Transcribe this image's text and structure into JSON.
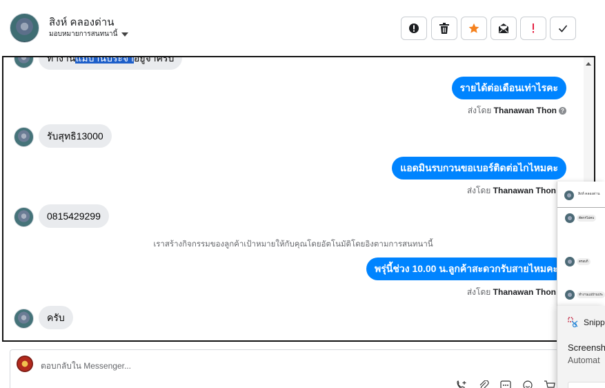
{
  "header": {
    "contact_name": "สิงห์ คลองด่าน",
    "assign_label": "มอบหมายการสนทนานี้"
  },
  "toolbar": {
    "buttons": [
      {
        "icon": "alert-circle-icon"
      },
      {
        "icon": "trash-icon"
      },
      {
        "icon": "star-icon",
        "color": "#f5821f"
      },
      {
        "icon": "mark-unread-icon"
      },
      {
        "icon": "exclamation-icon",
        "color": "#e41e3f"
      },
      {
        "icon": "checkmark-icon"
      }
    ]
  },
  "conversation": {
    "top_partial_message": {
      "before": "ทำงาน",
      "highlighted": "แม่บ้านประจำ",
      "after": "อยู่จ้าครับ"
    },
    "messages": [
      {
        "direction": "out",
        "text": "รายได้ต่อเดือนเท่าไรคะ",
        "sent_by_prefix": "ส่งโดย",
        "sender": "Thanawan Thon"
      },
      {
        "direction": "in",
        "text": "รับสุทธิ13000"
      },
      {
        "direction": "out",
        "text": "แอดมินรบกวนขอเบอร์ติดต่อไกไหมคะ",
        "sent_by_prefix": "ส่งโดย",
        "sender": "Thanawan Thon"
      },
      {
        "direction": "in",
        "text": "0815429299"
      },
      {
        "direction": "out",
        "text": "พรุ่นี้ช่วง 10.00 น.ลูกค้าสะดวกรับสายไหมคะ",
        "sent_by_prefix": "ส่งโดย",
        "sender": "Thanawan Thon"
      },
      {
        "direction": "in",
        "text": "ครับ"
      }
    ],
    "system_note": "เราสร้างกิจกรรมของลูกค้าเป้าหมายให้กับคุณโดยอัตโนมัติโดยอิงตามการสนทนานี้"
  },
  "composer": {
    "placeholder": "ตอบกลับใน Messenger..."
  },
  "snipping_tool": {
    "title": "Snipping Tool",
    "title_visible": "Snipp",
    "line1_visible": "Screensh",
    "line2_visible": "Automat",
    "thumb": {
      "name": "สิงห์ คลองด่าน",
      "bubbles": [
        "ดีตกรไม่คบ",
        "ตรอบกิ",
        "ทำงานแม่บ้านประ"
      ]
    }
  },
  "colors": {
    "outgoing_bubble": "#0084ff",
    "incoming_bubble": "#e9ebee",
    "highlight": "#1e5fc9"
  }
}
